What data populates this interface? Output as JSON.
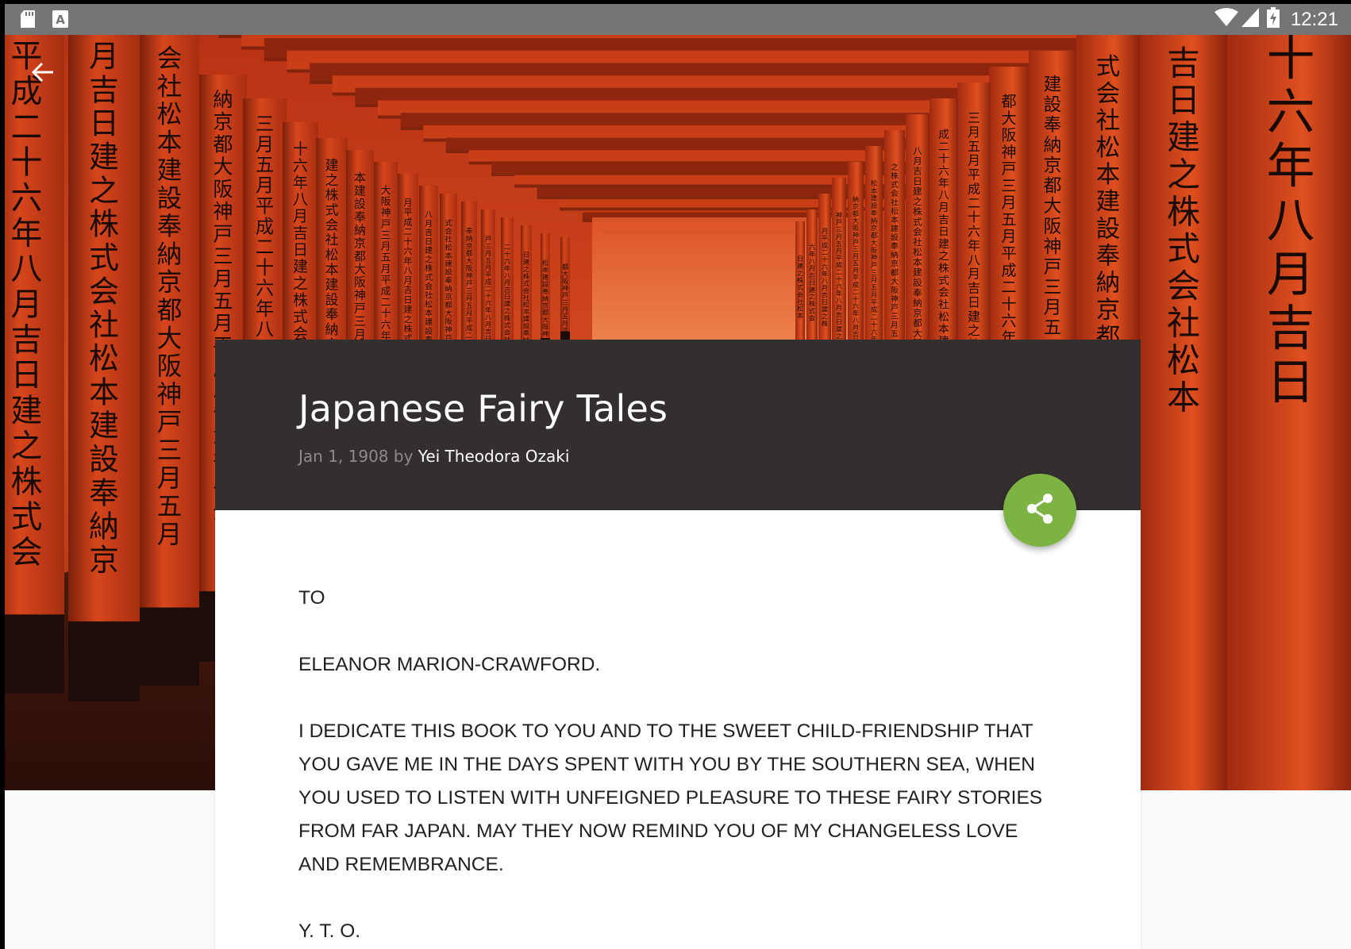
{
  "status_bar": {
    "time": "12:21",
    "left_icons": [
      "sd-card-icon",
      "text-a-icon"
    ],
    "right_icons": [
      "wifi-icon",
      "cell-signal-icon",
      "battery-charging-icon"
    ]
  },
  "app_bar": {
    "back_icon": "arrow-back-icon"
  },
  "book": {
    "title": "Japanese Fairy Tales",
    "date": "Jan 1, 1908",
    "by": " by ",
    "author": "Yei Theodora Ozaki"
  },
  "share": {
    "icon": "share-icon",
    "color": "#7cb342"
  },
  "content": {
    "paragraphs": [
      "TO",
      "ELEANOR MARION-CRAWFORD.",
      "I DEDICATE THIS BOOK TO YOU AND TO THE SWEET CHILD-FRIENDSHIP THAT YOU GAVE ME IN THE DAYS SPENT WITH YOU BY THE SOUTHERN SEA, WHEN YOU USED TO LISTEN WITH UNFEIGNED PLEASURE TO THESE FAIRY STORIES FROM FAR JAPAN. MAY THEY NOW REMIND YOU OF MY CHANGELESS LOVE AND REMEMBRANCE.",
      "Y. T. O."
    ]
  },
  "colors": {
    "status_bar": "#757575",
    "header_card": "#342f2f",
    "torii_red": "#d2401c"
  }
}
